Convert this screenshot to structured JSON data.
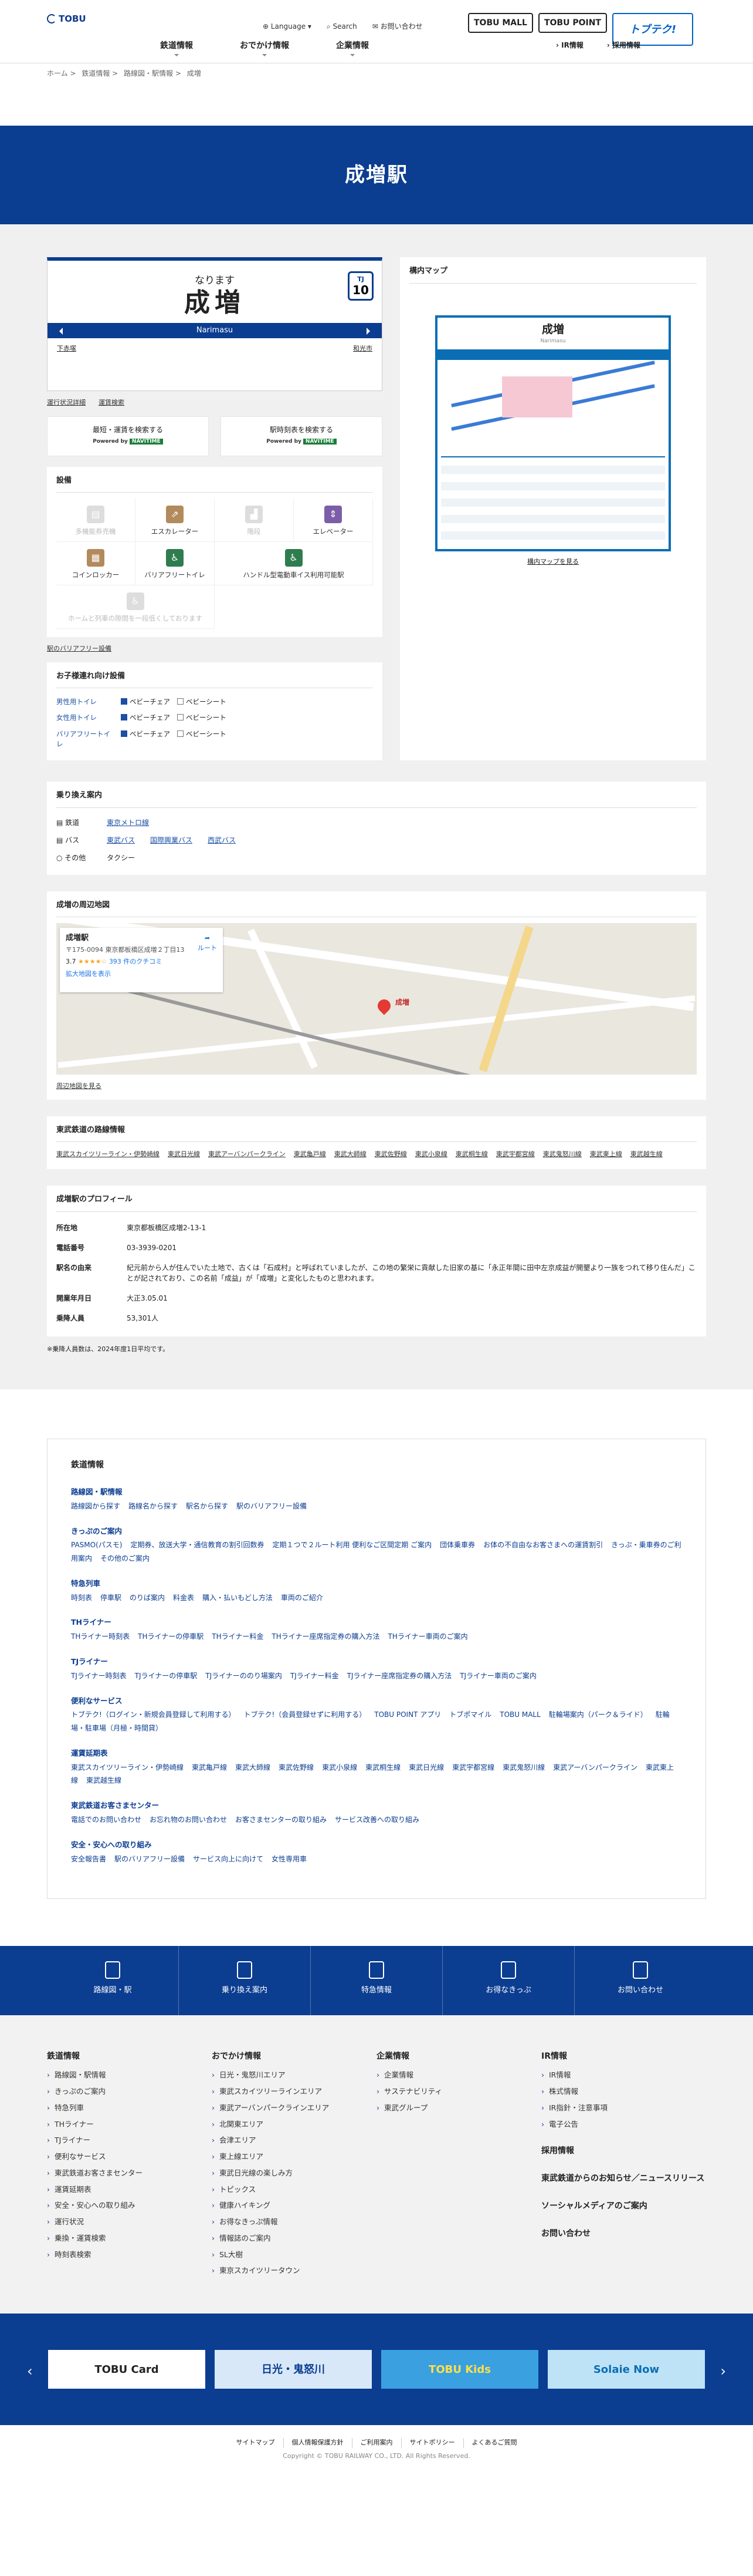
{
  "header": {
    "logo": "TOBU",
    "util": [
      "Language",
      "Search",
      "お問い合わせ"
    ],
    "buttons": [
      "TOBU MALL",
      "TOBU POINT"
    ],
    "tp_main": "トブテク!",
    "tp_sub": "採用情報",
    "nav": [
      "鉄道情報",
      "おでかけ情報",
      "企業情報"
    ],
    "nav_small": [
      "IR情報",
      "採用情報"
    ]
  },
  "breadcrumb": [
    "ホーム",
    "鉄道情報",
    "路線図・駅情報",
    "成増"
  ],
  "page_title": "成増駅",
  "sign": {
    "kana": "なります",
    "kanji": "成増",
    "romaji": "Narimasu",
    "line_code": "TJ",
    "number": "10",
    "prev": "下赤塚",
    "next": "和光市"
  },
  "sign_links": [
    "運行状況詳細",
    "運賃検索"
  ],
  "nav_buttons": [
    {
      "label": "最短・運賃を検索する",
      "powered": "Powered by",
      "brand": "NAVITIME"
    },
    {
      "label": "駅時刻表を検索する",
      "powered": "Powered by",
      "brand": "NAVITIME"
    }
  ],
  "facility": {
    "title": "設備",
    "items": [
      {
        "label": "多機能券売機",
        "on": false
      },
      {
        "label": "エスカレーター",
        "on": true
      },
      {
        "label": "階段",
        "on": false
      },
      {
        "label": "エレベーター",
        "on": true
      },
      {
        "label": "コインロッカー",
        "on": true
      },
      {
        "label": "バリアフリートイレ",
        "on": true
      },
      {
        "label": "ハンドル型電動車イス利用可能駅",
        "on": true
      },
      {
        "label": "ホームと列車の隙間を一段低くしております",
        "on": false
      }
    ],
    "link": "駅のバリアフリー設備"
  },
  "child": {
    "title": "お子様連れ向け設備",
    "rows": [
      {
        "k": "男性用トイレ",
        "a": "ベビーチェア",
        "b": "ベビーシート"
      },
      {
        "k": "女性用トイレ",
        "a": "ベビーチェア",
        "b": "ベビーシート"
      },
      {
        "k": "バリアフリートイレ",
        "a": "ベビーチェア",
        "b": "ベビーシート"
      }
    ]
  },
  "yard": {
    "title": "構内マップ",
    "map_title": "成増",
    "map_sub": "Narimasu",
    "link": "構内マップを見る"
  },
  "transfer": {
    "title": "乗り換え案内",
    "rows": [
      {
        "k": "鉄道",
        "v": [
          "東京メトロ線"
        ]
      },
      {
        "k": "バス",
        "v": [
          "東武バス",
          "国際興業バス",
          "西武バス"
        ]
      },
      {
        "k": "その他",
        "v": [
          "タクシー"
        ]
      }
    ]
  },
  "around": {
    "title": "成増の周辺地図",
    "place": "成増駅",
    "addr": "〒175-0094 東京都板橋区成増２丁目13",
    "rating": "3.7",
    "reviews": "393 件のクチコミ",
    "enlarge": "拡大地図を表示",
    "route": "ルート",
    "pin_label": "成増",
    "link": "周辺地図を見る"
  },
  "lines": {
    "title": "東武鉄道の路線情報",
    "items": [
      "東武スカイツリーライン・伊勢崎線",
      "東武日光線",
      "東武アーバンパークライン",
      "東武亀戸線",
      "東武大師線",
      "東武佐野線",
      "東武小泉線",
      "東武桐生線",
      "東武宇都宮線",
      "東武鬼怒川線",
      "東武東上線",
      "東武越生線"
    ]
  },
  "profile": {
    "title": "成増駅のプロフィール",
    "rows": [
      {
        "k": "所在地",
        "v": "東京都板橋区成増2-13-1"
      },
      {
        "k": "電話番号",
        "v": "03-3939-0201"
      },
      {
        "k": "駅名の由来",
        "v": "紀元前から人が住んでいた土地で、古くは「石成村」と呼ばれていましたが、この地の繁栄に貢献した旧家の基に「永正年間に田中左京成益が開墾より一族をつれて移り住んだ」ことが記されており、この名前「成益」が「成増」と変化したものと思われます。"
      },
      {
        "k": "開業年月日",
        "v": "大正3.05.01"
      },
      {
        "k": "乗降人員",
        "v": "53,301人"
      }
    ],
    "note": "※乗降人員数は、2024年度1日平均です。"
  },
  "footer_links": {
    "title": "鉄道情報",
    "sections": [
      {
        "h": "路線図・駅情報",
        "items": [
          "路線図から探す",
          "路線名から探す",
          "駅名から探す",
          "駅のバリアフリー設備"
        ]
      },
      {
        "h": "きっぷのご案内",
        "items": [
          "PASMO(パスモ)",
          "定期券、放送大学・通信教育の割引回数券",
          "定期１つで２ルート利用 便利なご区間定期 ご案内",
          "団体乗車券",
          "お体の不自由なお客さまへの運賃割引",
          "きっぷ・乗車券のご利用案内",
          "その他のご案内"
        ]
      },
      {
        "h": "特急列車",
        "items": [
          "時刻表",
          "停車駅",
          "のりば案内",
          "料金表",
          "購入・払いもどし方法",
          "車両のご紹介"
        ]
      },
      {
        "h": "THライナー",
        "items": [
          "THライナー時刻表",
          "THライナーの停車駅",
          "THライナー料金",
          "THライナー座席指定券の購入方法",
          "THライナー車両のご案内"
        ]
      },
      {
        "h": "TJライナー",
        "items": [
          "TJライナー時刻表",
          "TJライナーの停車駅",
          "TJライナーののり場案内",
          "TJライナー料金",
          "TJライナー座席指定券の購入方法",
          "TJライナー車両のご案内"
        ]
      },
      {
        "h": "便利なサービス",
        "items": [
          "トブテク!（ログイン・新規会員登録して利用する）",
          "トブテク!（会員登録せずに利用する）",
          "TOBU POINT アプリ",
          "トブポマイル",
          "TOBU MALL",
          "駐輪場案内（パーク＆ライド）",
          "駐輪場・駐車場（月極・時間貸）"
        ]
      },
      {
        "h": "運賃延期表",
        "items": [
          "東武スカイツリーライン・伊勢崎線",
          "東武亀戸線",
          "東武大師線",
          "東武佐野線",
          "東武小泉線",
          "東武桐生線",
          "東武日光線",
          "東武宇都宮線",
          "東武鬼怒川線",
          "東武アーバンパークライン",
          "東武東上線",
          "東武越生線"
        ]
      },
      {
        "h": "東武鉄道お客さまセンター",
        "items": [
          "電話でのお問い合わせ",
          "お忘れ物のお問い合わせ",
          "お客さまセンターの取り組み",
          "サービス改善への取り組み"
        ]
      },
      {
        "h": "安全・安心への取り組み",
        "items": [
          "安全報告書",
          "駅のバリアフリー設備",
          "サービス向上に向けて",
          "女性専用車"
        ]
      }
    ]
  },
  "shortcuts": [
    "路線図・駅",
    "乗り換え案内",
    "特急情報",
    "お得なきっぷ",
    "お問い合わせ"
  ],
  "fnav": [
    {
      "h": "鉄道情報",
      "items": [
        "路線図・駅情報",
        "きっぷのご案内",
        "特急列車",
        "THライナー",
        "TJライナー",
        "便利なサービス",
        "東武鉄道お客さまセンター",
        "運賃延期表",
        "安全・安心への取り組み",
        "運行状況",
        "乗換・運賃検索",
        "時刻表検索"
      ]
    },
    {
      "h": "おでかけ情報",
      "items": [
        "日光・鬼怒川エリア",
        "東武スカイツリーラインエリア",
        "東武アーバンパークラインエリア",
        "北関東エリア",
        "会津エリア",
        "東上線エリア",
        "東武日光線の楽しみ方",
        "トピックス",
        "健康ハイキング",
        "お得なきっぷ情報",
        "情報誌のご案内",
        "SL大樹",
        "東京スカイツリータウン"
      ]
    },
    {
      "h": "企業情報",
      "items": [
        "企業情報",
        "サステナビリティ",
        "東武グループ"
      ]
    },
    {
      "h": "IR情報",
      "items": [
        "IR情報",
        "株式情報",
        "IR指針・注意事項",
        "電子公告"
      ],
      "extra": [
        "採用情報",
        "東武鉄道からのお知らせ／ニュースリリース",
        "ソーシャルメディアのご案内",
        "お問い合わせ"
      ]
    }
  ],
  "banners": [
    "TOBU Card",
    "日光・鬼怒川",
    "TOBU Kids",
    "Solaie Now"
  ],
  "copyright": {
    "links": [
      "サイトマップ",
      "個人情報保護方針",
      "ご利用案内",
      "サイトポリシー",
      "よくあるご質問"
    ],
    "text": "Copyright © TOBU RAILWAY CO., LTD. All Rights Reserved."
  }
}
